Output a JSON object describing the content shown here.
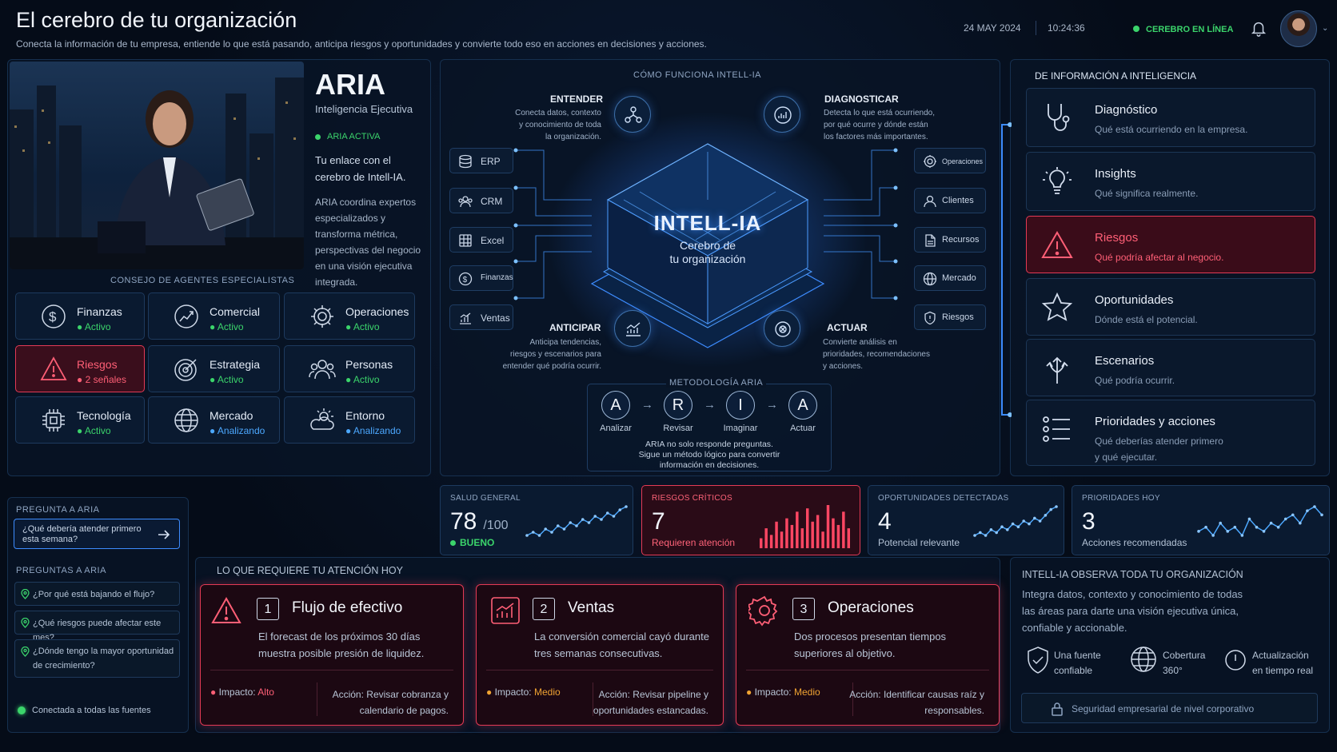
{
  "header": {
    "title": "El cerebro de tu organización",
    "subtitle": "Conecta la información de tu empresa, entiende lo que está pasando, anticipa riesgos y oportunidades y convierte todo eso en acciones en decisiones y acciones.",
    "date": "24 MAY 2024",
    "time": "10:24:36",
    "status": "CEREBRO EN LÍNEA"
  },
  "aria": {
    "name": "ARIA",
    "role": "Inteligencia Ejecutiva",
    "status": "ARIA ACTIVA",
    "intro": "Tu enlace con el cerebro de Intell-IA.",
    "desc": "ARIA coordina expertos especializados y transforma métrica, perspectivas del negocio en una visión ejecutiva integrada."
  },
  "agents": {
    "title": "CONSEJO DE AGENTES ESPECIALISTAS",
    "items": [
      {
        "name": "Finanzas",
        "status": "Activo"
      },
      {
        "name": "Comercial",
        "status": "Activo"
      },
      {
        "name": "Operaciones",
        "status": "Activo"
      },
      {
        "name": "Riesgos",
        "status": "2 señales"
      },
      {
        "name": "Estrategia",
        "status": "Activo"
      },
      {
        "name": "Personas",
        "status": "Activo"
      },
      {
        "name": "Tecnología",
        "status": "Activo"
      },
      {
        "name": "Mercado",
        "status": "Analizando"
      },
      {
        "name": "Entorno",
        "status": "Analizando"
      }
    ]
  },
  "how": {
    "title": "CÓMO FUNCIONA INTELL-IA",
    "core_title": "INTELL-IA",
    "core_sub1": "Cerebro de",
    "core_sub2": "tu organización",
    "stages": {
      "entender": {
        "h": "ENTENDER",
        "d1": "Conecta datos, contexto",
        "d2": "y conocimiento de toda",
        "d3": "la organización."
      },
      "diagnosticar": {
        "h": "DIAGNOSTICAR",
        "d1": "Detecta lo que está ocurriendo,",
        "d2": "por qué ocurre y dónde están",
        "d3": "los factores más importantes."
      },
      "anticipar": {
        "h": "ANTICIPAR",
        "d1": "Anticipa tendencias,",
        "d2": "riesgos y escenarios para",
        "d3": "entender qué podría ocurrir."
      },
      "actuar": {
        "h": "ACTUAR",
        "d1": "Convierte análisis en",
        "d2": "prioridades, recomendaciones",
        "d3": "y acciones."
      }
    },
    "sources": [
      "ERP",
      "CRM",
      "Excel",
      "Finanzas",
      "Ventas"
    ],
    "outputs": [
      "Operaciones",
      "Clientes",
      "Recursos",
      "Mercado",
      "Riesgos"
    ],
    "method": {
      "title": "METODOLOGÍA ARIA",
      "steps": [
        {
          "letter": "A",
          "label": "Analizar"
        },
        {
          "letter": "R",
          "label": "Revisar"
        },
        {
          "letter": "I",
          "label": "Imaginar"
        },
        {
          "letter": "A",
          "label": "Actuar"
        }
      ],
      "note1": "ARIA no solo responde preguntas.",
      "note2": "Sigue un método lógico para convertir",
      "note3": "información en decisiones."
    }
  },
  "intel": {
    "title": "DE INFORMACIÓN A INTELIGENCIA",
    "cards": [
      {
        "h": "Diagnóstico",
        "d": "Qué está ocurriendo en la empresa."
      },
      {
        "h": "Insights",
        "d": "Qué significa realmente."
      },
      {
        "h": "Riesgos",
        "d": "Qué podría afectar al negocio."
      },
      {
        "h": "Oportunidades",
        "d": "Dónde está el potencial."
      },
      {
        "h": "Escenarios",
        "d": "Qué podría ocurrir."
      },
      {
        "h": "Prioridades y acciones",
        "d": "Qué deberías atender primero",
        "d2": "y qué ejecutar."
      }
    ]
  },
  "kpis": [
    {
      "label": "SALUD GENERAL",
      "value": "78",
      "unit": "/100",
      "sub": "BUENO",
      "spark": [
        3,
        4,
        3,
        5,
        4,
        6,
        5,
        7,
        6,
        8,
        7,
        9,
        8,
        10,
        9,
        11,
        12
      ]
    },
    {
      "label": "RIESGOS CRÍTICOS",
      "value": "7",
      "sub": "Requieren atención",
      "bars": [
        3,
        6,
        4,
        8,
        5,
        9,
        7,
        11,
        6,
        12,
        8,
        10,
        5,
        13,
        9,
        7,
        11,
        6
      ]
    },
    {
      "label": "OPORTUNIDADES DETECTADAS",
      "value": "4",
      "sub": "Potencial relevante",
      "spark": [
        2,
        3,
        2,
        4,
        3,
        5,
        4,
        6,
        5,
        7,
        6,
        8,
        7,
        9,
        11,
        12
      ]
    },
    {
      "label": "PRIORIDADES HOY",
      "value": "3",
      "sub": "Acciones recomendadas",
      "spark": [
        5,
        6,
        4,
        7,
        5,
        6,
        4,
        8,
        6,
        5,
        7,
        6,
        8,
        9,
        7,
        10,
        11,
        9
      ]
    }
  ],
  "ask": {
    "title": "PREGUNTA A ARIA",
    "placeholder": "¿Qué debería atender primero esta semana?",
    "list_title": "PREGUNTAS A ARIA",
    "questions": [
      "¿Por qué está bajando el flujo?",
      "¿Qué riesgos puede afectar este mes?",
      "¿Dónde tengo la mayor oportunidad de crecimiento?"
    ],
    "connected": "Conectada a todas las fuentes"
  },
  "attention": {
    "title": "LO QUE REQUIERE TU ATENCIÓN HOY",
    "items": [
      {
        "num": "1",
        "title": "Flujo de efectivo",
        "desc": "El forecast de los próximos 30 días muestra posible presión de liquidez.",
        "impact_label": "Impacto:",
        "impact": "Alto",
        "action_label": "Acción:",
        "action": "Revisar cobranza y calendario de pagos."
      },
      {
        "num": "2",
        "title": "Ventas",
        "desc": "La conversión comercial cayó durante tres semanas consecutivas.",
        "impact_label": "Impacto:",
        "impact": "Medio",
        "action_label": "Acción:",
        "action": "Revisar pipeline y oportunidades estancadas."
      },
      {
        "num": "3",
        "title": "Operaciones",
        "desc": "Dos procesos presentan tiempos superiores al objetivo.",
        "impact_label": "Impacto:",
        "impact": "Medio",
        "action_label": "Acción:",
        "action": "Identificar causas raíz y responsables."
      }
    ]
  },
  "observe": {
    "title": "INTELL-IA OBSERVA TODA TU ORGANIZACIÓN",
    "desc": "Integra datos, contexto y conocimiento de todas las áreas para darte una visión ejecutiva única, confiable y accionable.",
    "features": [
      {
        "a": "Una fuente",
        "b": "confiable"
      },
      {
        "a": "Cobertura",
        "b": "360°"
      },
      {
        "a": "Actualización",
        "b": "en tiempo real"
      }
    ],
    "security": "Seguridad empresarial de nivel corporativo"
  },
  "colors": {
    "accent": "#4ca8ff",
    "ok": "#3bd46b",
    "alert": "#e43a55",
    "warn": "#f0a332"
  }
}
